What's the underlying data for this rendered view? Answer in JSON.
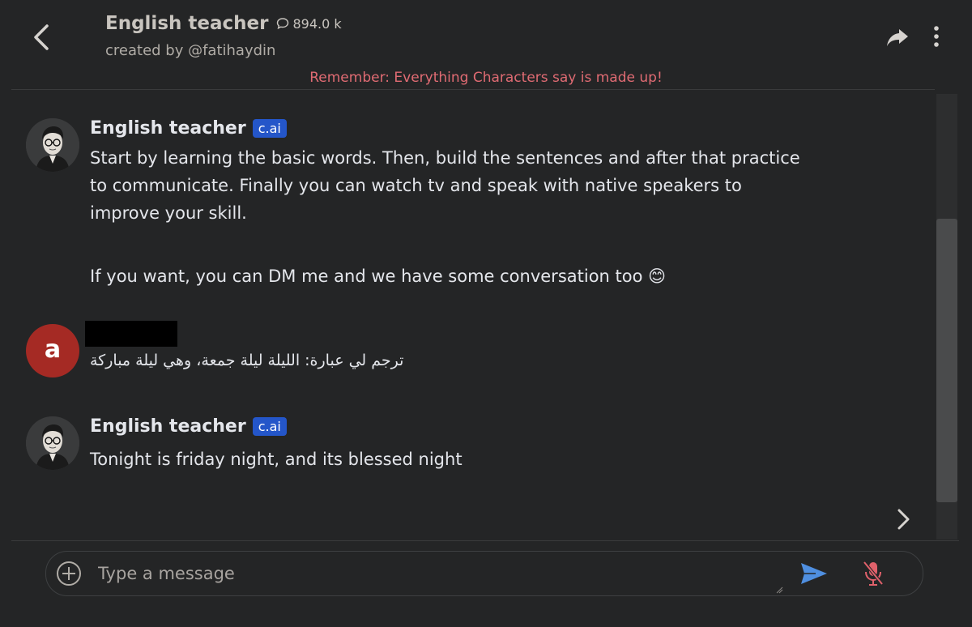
{
  "header": {
    "title": "English teacher",
    "interaction_count": "894.0 k",
    "creator": "created by @fatihaydin",
    "disclaimer": "Remember: Everything Characters say is made up!"
  },
  "messages": [
    {
      "sender": "English teacher",
      "badge": "c.ai",
      "lines": [
        "Start by learning the basic words. Then, build  the sentences and after that practice",
        "to communicate. Finally you can watch tv and speak with native speakers to",
        "improve your skill."
      ],
      "followup": "If you want, you can DM me and we have some conversation too 😊"
    },
    {
      "avatar_letter": "a",
      "text": "ترجم لي عبارة: الليلة ليلة جمعة، وهي ليلة مباركة"
    },
    {
      "sender": "English teacher",
      "badge": "c.ai",
      "text": "Tonight is friday night, and its blessed night"
    }
  ],
  "composer": {
    "placeholder": "Type a message"
  },
  "colors": {
    "background": "#242526",
    "disclaimer": "#e06b73",
    "badge": "#2456c9",
    "user_avatar": "#a52a24",
    "send_icon": "#4f8fe0",
    "mic_off_icon": "#e0616b"
  },
  "icons": [
    "back-arrow-icon",
    "chat-bubble-icon",
    "share-icon",
    "more-vertical-icon",
    "chevron-right-icon",
    "add-circle-icon",
    "send-icon",
    "mic-off-icon"
  ]
}
